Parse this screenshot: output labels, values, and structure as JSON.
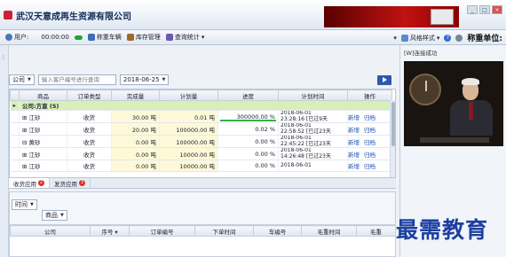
{
  "app": {
    "title": "武汉天意成再生资源有限公司"
  },
  "toolbar": {
    "user_label": "用户:",
    "timer": "00:00:00",
    "weigh_car": "称重车辆",
    "stock_mgmt": "库存管理",
    "query_stats": "查询统计",
    "theme": "风格样式",
    "help": "?",
    "unit_label": "称重单位:"
  },
  "filter": {
    "company_select": "公司",
    "search_placeholder": "输入客户编号进行查询",
    "date": "2018-06-25"
  },
  "grid": {
    "columns": [
      "商品",
      "订单类型",
      "完成量",
      "计划量",
      "进度",
      "计划时间",
      "操作"
    ],
    "group_label": "公司:方直 (5)",
    "rows": [
      {
        "name": "江砂",
        "type": "收货",
        "done": "30.00 吨",
        "plan": "0.01 吨",
        "progress": "300000.00 %",
        "time1": "2018-06-01",
        "time2": "23:28:16 [已过9天",
        "op1": "新增",
        "op2": "归档"
      },
      {
        "name": "江砂",
        "type": "收货",
        "done": "20.00 吨",
        "plan": "100000.00 吨",
        "progress": "0.02 %",
        "time1": "2018-06-01",
        "time2": "22:58:52 [已过23天",
        "op1": "新增",
        "op2": "归档"
      },
      {
        "name": "黄砂",
        "type": "收货",
        "done": "0.00 吨",
        "plan": "100000.00 吨",
        "progress": "0.00 %",
        "time1": "2018-06-01",
        "time2": "22:45:22 [已过23天",
        "op1": "新增",
        "op2": "归档"
      },
      {
        "name": "江砂",
        "type": "收货",
        "done": "0.00 吨",
        "plan": "10000.00 吨",
        "progress": "0.00 %",
        "time1": "2018-06-01",
        "time2": "14:26:48 [已过23天",
        "op1": "新增",
        "op2": "归档"
      },
      {
        "name": "江砂",
        "type": "收货",
        "done": "0.00 吨",
        "plan": "10000.00 吨",
        "progress": "0.00 %",
        "time1": "2018-06-01",
        "time2": "",
        "op1": "新增",
        "op2": "归档"
      }
    ]
  },
  "tabs": [
    {
      "label": "收货应用",
      "badge": "2"
    },
    {
      "label": "发货应用",
      "badge": "3"
    }
  ],
  "lower": {
    "time_select": "时间",
    "product_select": "商品",
    "columns": [
      "公司",
      "序号",
      "订单编号",
      "下单时间",
      "车编号",
      "毛重时间",
      "毛重"
    ]
  },
  "right_panel": {
    "status": "[W]连接成功"
  },
  "watermark": "最需教育",
  "colors": {
    "accent": "#1d3fa0",
    "group_row": "#d8f0b8",
    "progress": "#2fb24a",
    "badge": "#d9302b"
  }
}
